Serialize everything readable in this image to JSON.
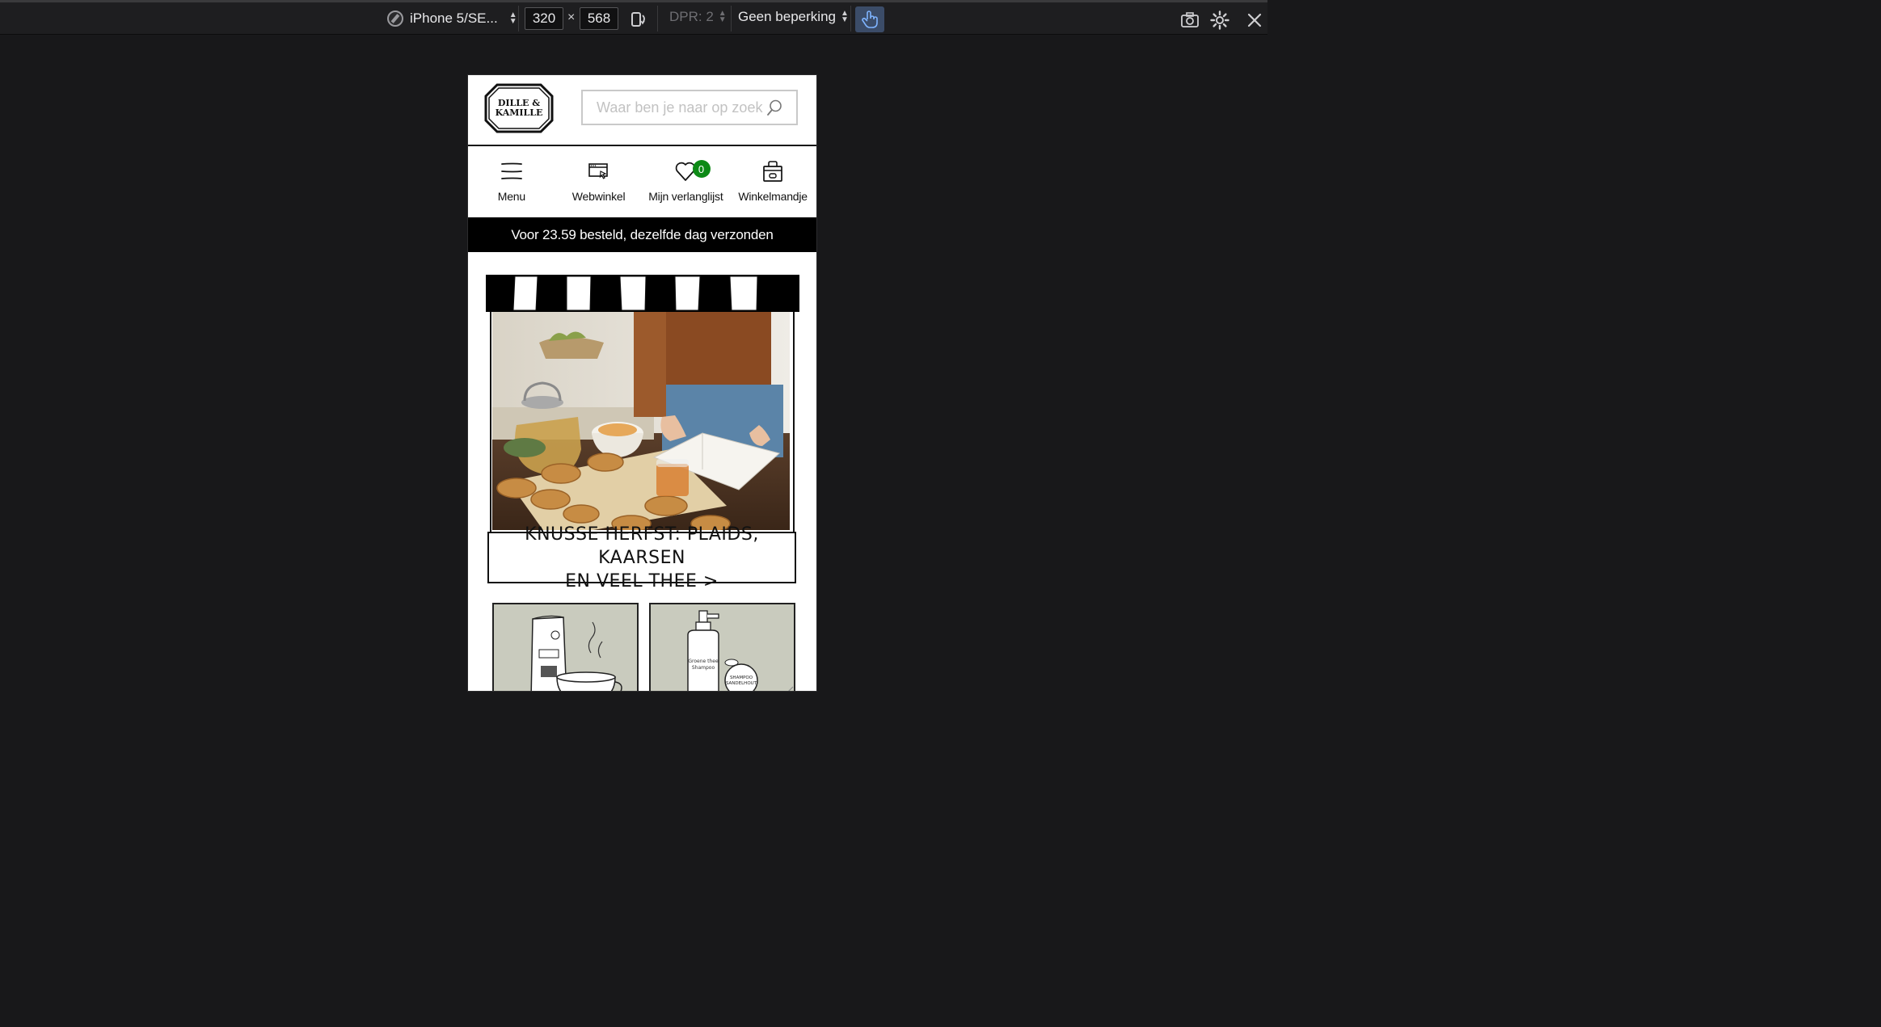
{
  "devtools": {
    "device_name": "iPhone 5/SE...",
    "width": "320",
    "times": "×",
    "height": "568",
    "dpr": "DPR: 2",
    "throttling": "Geen beperking",
    "icons": [
      "compass-icon",
      "rotate-device-icon",
      "touch-simulation-icon",
      "screenshot-icon",
      "settings-icon",
      "close-icon"
    ]
  },
  "site": {
    "logo_line1": "DILLE &",
    "logo_line2": "KAMILLE",
    "search_placeholder": "Waar ben je naar op zoek",
    "nav": [
      {
        "label": "Menu",
        "icon": "menu-icon"
      },
      {
        "label": "Webwinkel",
        "icon": "webshop-icon"
      },
      {
        "label": "Mijn verlanglijst",
        "icon": "heart-icon",
        "badge": "0"
      },
      {
        "label": "Winkelmandje",
        "icon": "basket-icon"
      }
    ],
    "promo": "Voor 23.59 besteld, dezelfde dag verzonden",
    "hero_caption_line1": "KNUSSE HERFST: PLAIDS, KAARSEN",
    "hero_caption_line2": "EN VEEL THEE >",
    "colors": {
      "badge": "#0d8a16",
      "promo_bg": "#000000",
      "tile_bg": "#c9cbbe",
      "touch_active": "#3b4c68"
    }
  }
}
